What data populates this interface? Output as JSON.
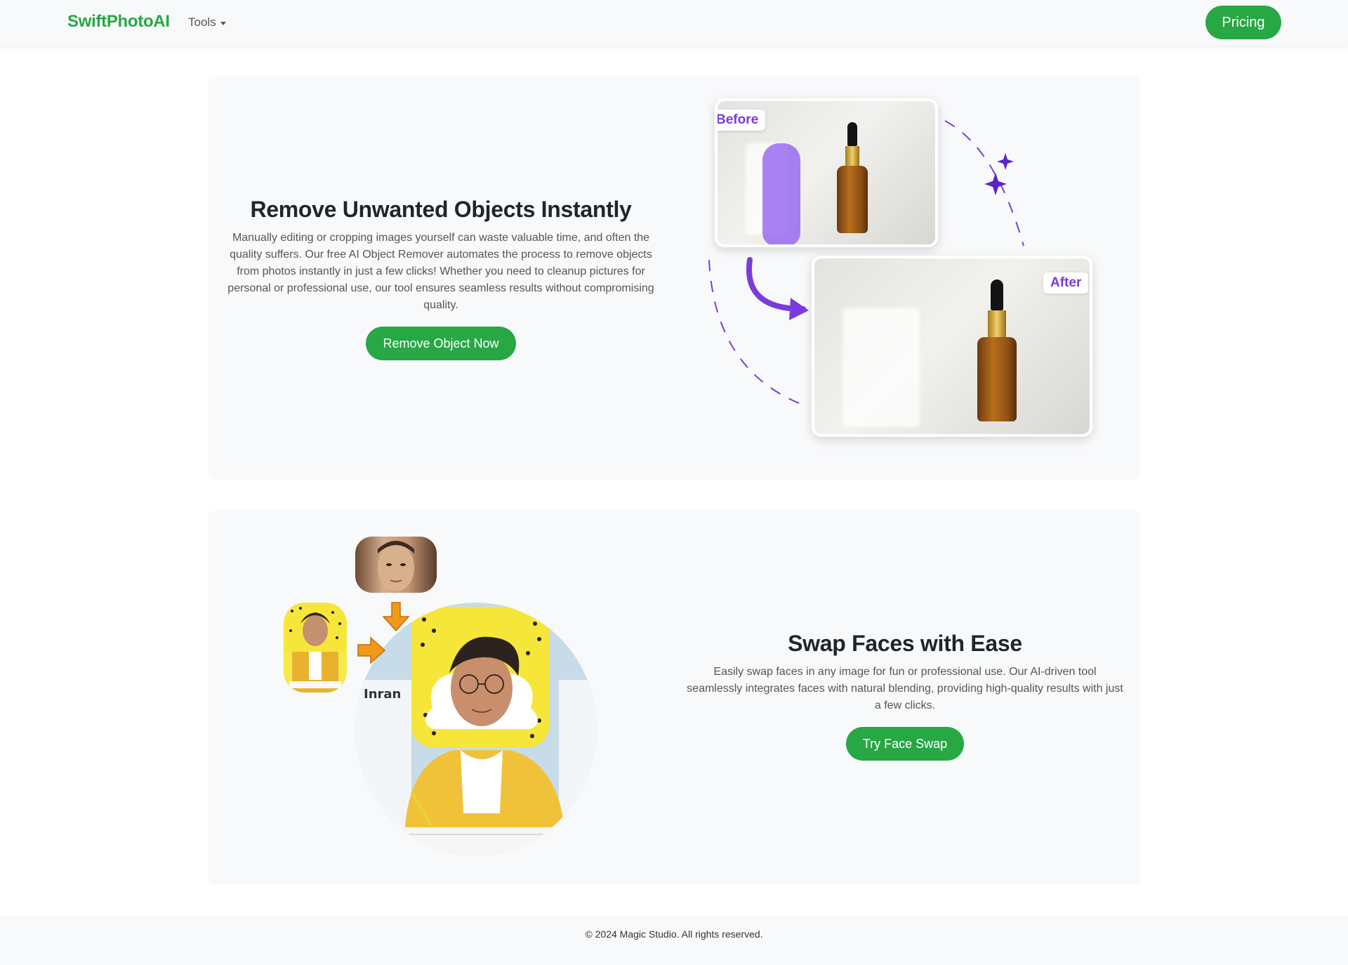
{
  "navbar": {
    "brand": "SwiftPhotoAI",
    "tools_label": "Tools",
    "pricing_label": "Pricing"
  },
  "section_object_remover": {
    "heading": "Remove Unwanted Objects Instantly",
    "description": "Manually editing or cropping images yourself can waste valuable time, and often the quality suffers. Our free AI Object Remover automates the process to remove objects from photos instantly in just a few clicks! Whether you need to cleanup pictures for personal or professional use, our tool ensures seamless results without compromising quality.",
    "cta_label": "Remove Object Now",
    "before_label": "Before",
    "after_label": "After"
  },
  "section_face_swap": {
    "heading": "Swap Faces with Ease",
    "description": "Easily swap faces in any image for fun or professional use. Our AI-driven tool seamlessly integrates faces with natural blending, providing high-quality results with just a few clicks.",
    "cta_label": "Try Face Swap",
    "illustration_profile_name": "Inran"
  },
  "footer": {
    "copyright": "© 2024 Magic Studio. All rights reserved."
  },
  "colors": {
    "brand_green": "#28a745",
    "accent_purple": "#7a3bdc",
    "card_bg": "#f8f9fa"
  }
}
